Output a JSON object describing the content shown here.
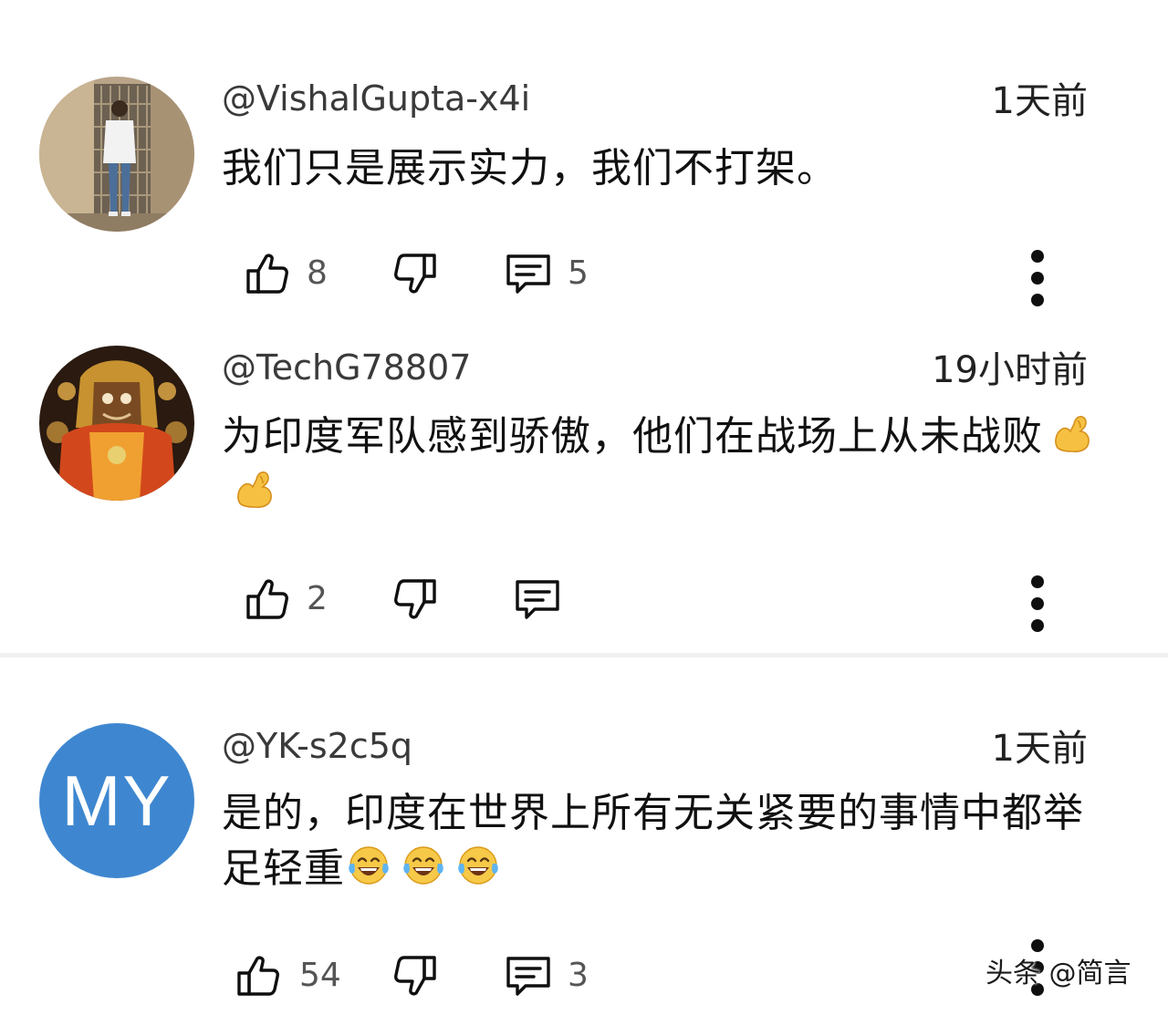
{
  "comments": [
    {
      "handle": "@VishalGupta-x4i",
      "time": "1天前",
      "text": "我们只是展示实力，我们不打架。",
      "likes": "8",
      "replies": "5",
      "avatar": "photo-man-doorway"
    },
    {
      "handle": "@TechG78807",
      "time": "19小时前",
      "text": "为印度军队感到骄傲，他们在战场上从未战败",
      "emojis": [
        "flexed-biceps-emoji",
        "flexed-biceps-emoji"
      ],
      "likes": "2",
      "replies": "",
      "avatar": "deity-idol-image"
    },
    {
      "handle": "@YK-s2c5q",
      "time": "1天前",
      "text": "是的，印度在世界上所有无关紧要的事情中都举足轻重",
      "emojis": [
        "tears-of-joy-emoji",
        "tears-of-joy-emoji",
        "tears-of-joy-emoji"
      ],
      "likes": "54",
      "replies": "3",
      "avatar_initials": "MY",
      "avatar_color": "#3e87d0"
    }
  ],
  "watermark": "头条 @简言",
  "icons": {
    "like": "thumbs-up-icon",
    "dislike": "thumbs-down-icon",
    "reply": "reply-comment-icon",
    "more": "more-vertical-icon"
  }
}
